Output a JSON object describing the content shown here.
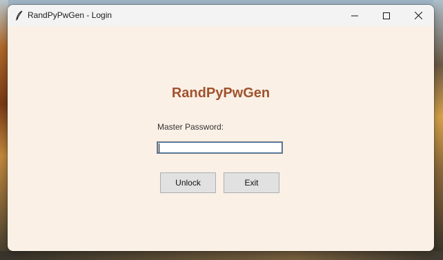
{
  "window": {
    "title": "RandPyPwGen - Login",
    "controls": {
      "minimize": "minimize-icon",
      "maximize": "maximize-icon",
      "close": "close-icon"
    },
    "app_icon": "feather-icon"
  },
  "login": {
    "heading": "RandPyPwGen",
    "password_label": "Master Password:",
    "password_value": "",
    "unlock_label": "Unlock",
    "exit_label": "Exit"
  },
  "colors": {
    "background": "#faf0e6",
    "heading": "#a0522d",
    "button": "#e1e1e1"
  }
}
